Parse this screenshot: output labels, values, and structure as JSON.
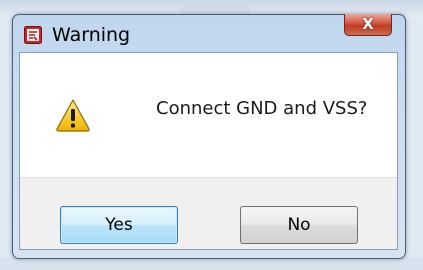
{
  "dialog": {
    "title": "Warning",
    "message": "Connect GND and VSS?",
    "close_label": "X",
    "buttons": {
      "yes": "Yes",
      "no": "No"
    },
    "icons": {
      "app": "app-icon",
      "warning": "warning-icon"
    },
    "colors": {
      "close_red": "#c8482f",
      "warning_yellow": "#f3c217",
      "default_button_border": "#3c7fb1"
    }
  }
}
